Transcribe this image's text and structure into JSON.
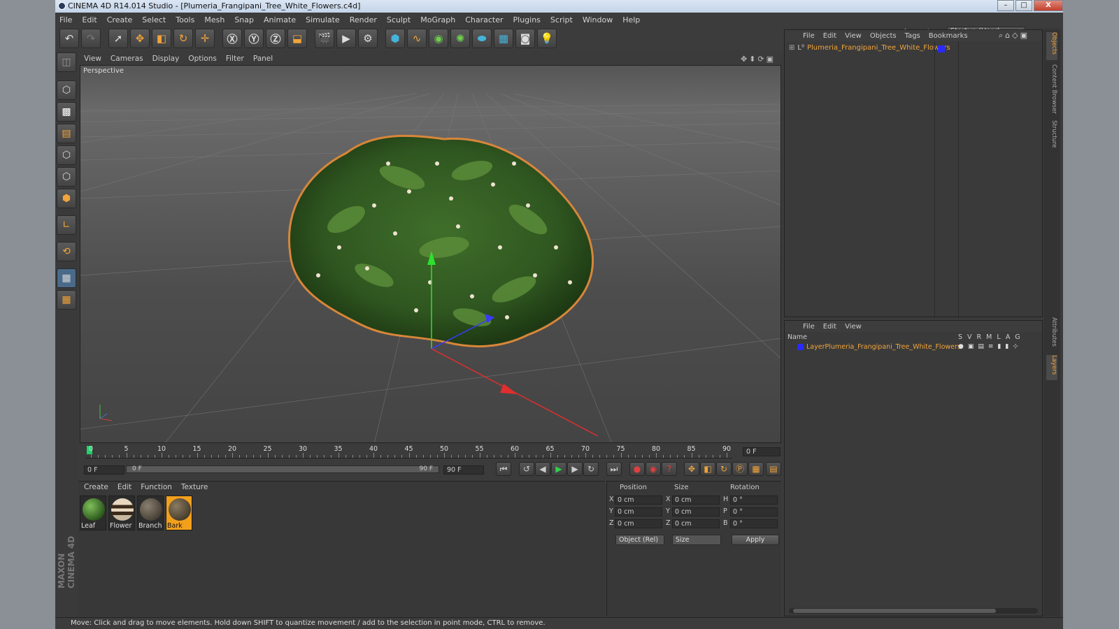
{
  "window": {
    "title": "CINEMA 4D R14.014 Studio - [Plumeria_Frangipani_Tree_White_Flowers.c4d]",
    "minimize": "–",
    "maximize": "□",
    "close": "X"
  },
  "menu": [
    "File",
    "Edit",
    "Create",
    "Select",
    "Tools",
    "Mesh",
    "Snap",
    "Animate",
    "Simulate",
    "Render",
    "Sculpt",
    "MoGraph",
    "Character",
    "Plugins",
    "Script",
    "Window",
    "Help"
  ],
  "layout": {
    "label": "Layout:",
    "value": "Startup (User)"
  },
  "viewport": {
    "menu": [
      "View",
      "Cameras",
      "Display",
      "Options",
      "Filter",
      "Panel"
    ],
    "label": "Perspective"
  },
  "timeline": {
    "ticks": [
      "0",
      "5",
      "10",
      "15",
      "20",
      "25",
      "30",
      "35",
      "40",
      "45",
      "50",
      "55",
      "60",
      "65",
      "70",
      "75",
      "80",
      "85",
      "90"
    ],
    "current_frame": "0 F",
    "start_field": "0 F",
    "range_start": "0 F",
    "range_end": "90 F",
    "end_field": "90 F"
  },
  "material_manager": {
    "menu": [
      "Create",
      "Edit",
      "Function",
      "Texture"
    ],
    "materials": [
      {
        "name": "Leaf",
        "selected": false
      },
      {
        "name": "Flower",
        "selected": false
      },
      {
        "name": "Branch",
        "selected": false
      },
      {
        "name": "Bark",
        "selected": true
      }
    ]
  },
  "coordinates": {
    "headers": {
      "position": "Position",
      "size": "Size",
      "rotation": "Rotation"
    },
    "rows": [
      {
        "pos_axis": "X",
        "pos": "0 cm",
        "size_axis": "X",
        "size": "0 cm",
        "rot_axis": "H",
        "rot": "0 °"
      },
      {
        "pos_axis": "Y",
        "pos": "0 cm",
        "size_axis": "Y",
        "size": "0 cm",
        "rot_axis": "P",
        "rot": "0 °"
      },
      {
        "pos_axis": "Z",
        "pos": "0 cm",
        "size_axis": "Z",
        "size": "0 cm",
        "rot_axis": "B",
        "rot": "0 °"
      }
    ],
    "mode": "Object (Rel)",
    "size_mode": "Size",
    "apply": "Apply"
  },
  "object_manager": {
    "menu": [
      "File",
      "Edit",
      "View",
      "Objects",
      "Tags",
      "Bookmarks"
    ],
    "object": "Plumeria_Frangipani_Tree_White_Flowers"
  },
  "layer_manager": {
    "menu": [
      "File",
      "Edit",
      "View"
    ],
    "column_name": "Name",
    "columns": [
      "S",
      "V",
      "R",
      "M",
      "L",
      "A",
      "G"
    ],
    "layer": "LayerPlumeria_Frangipani_Tree_White_Flowers"
  },
  "side_tabs": [
    "Objects",
    "Content Browser",
    "Structure",
    "Attributes",
    "Layers"
  ],
  "brand": "MAXON CINEMA 4D",
  "status": "Move: Click and drag to move elements. Hold down SHIFT to quantize movement / add to the selection in point mode, CTRL to remove.",
  "colors": {
    "accent": "#f2a43a",
    "playhead": "#1fd26a",
    "layer_color": "#2a2aff"
  }
}
